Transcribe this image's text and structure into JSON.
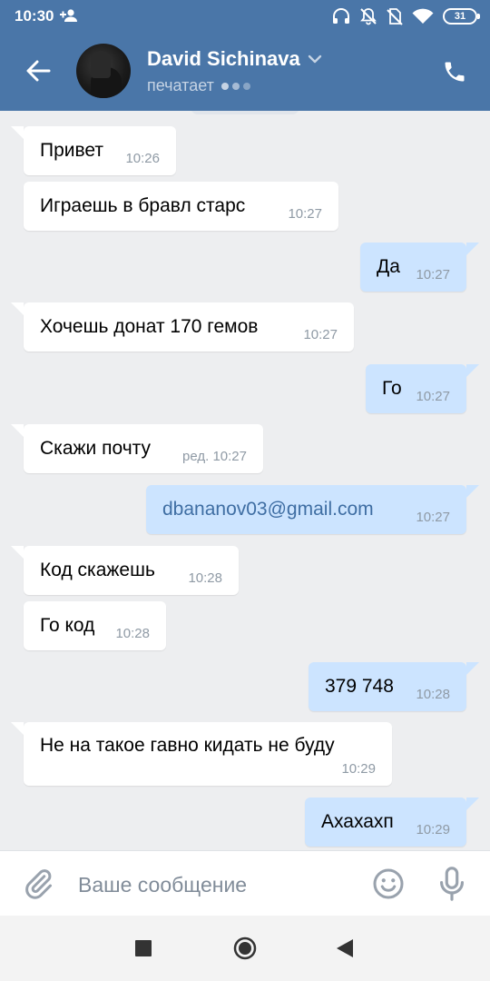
{
  "status_bar": {
    "time": "10:30",
    "battery": "31"
  },
  "header": {
    "contact_name": "David Sichinava",
    "status": "печатает"
  },
  "messages": [
    {
      "dir": "in",
      "text": "Привет",
      "time": "10:26"
    },
    {
      "dir": "in",
      "text": "Играешь в бравл старс",
      "time": "10:27"
    },
    {
      "dir": "out",
      "text": "Да",
      "time": "10:27"
    },
    {
      "dir": "in",
      "text": "Хочешь донат 170 гемов",
      "time": "10:27"
    },
    {
      "dir": "out",
      "text": "Го",
      "time": "10:27"
    },
    {
      "dir": "in",
      "text": "Скажи почту",
      "time": "ред. 10:27"
    },
    {
      "dir": "out",
      "text": "dbananov03@gmail.com",
      "time": "10:27"
    },
    {
      "dir": "in",
      "text": "Код скажешь",
      "time": "10:28"
    },
    {
      "dir": "in",
      "text": "Го код",
      "time": "10:28"
    },
    {
      "dir": "out",
      "text": "379 748",
      "time": "10:28"
    },
    {
      "dir": "in",
      "text": "Не на такое гавно кидать не буду",
      "time": "10:29"
    },
    {
      "dir": "out",
      "text": "Ахахахп",
      "time": "10:29"
    }
  ],
  "input": {
    "placeholder": "Ваше сообщение"
  },
  "colors": {
    "header": "#4a76a8",
    "incoming": "#ffffff",
    "outgoing": "#cce4ff",
    "background": "#edeef0",
    "link": "#3f6ea3"
  }
}
